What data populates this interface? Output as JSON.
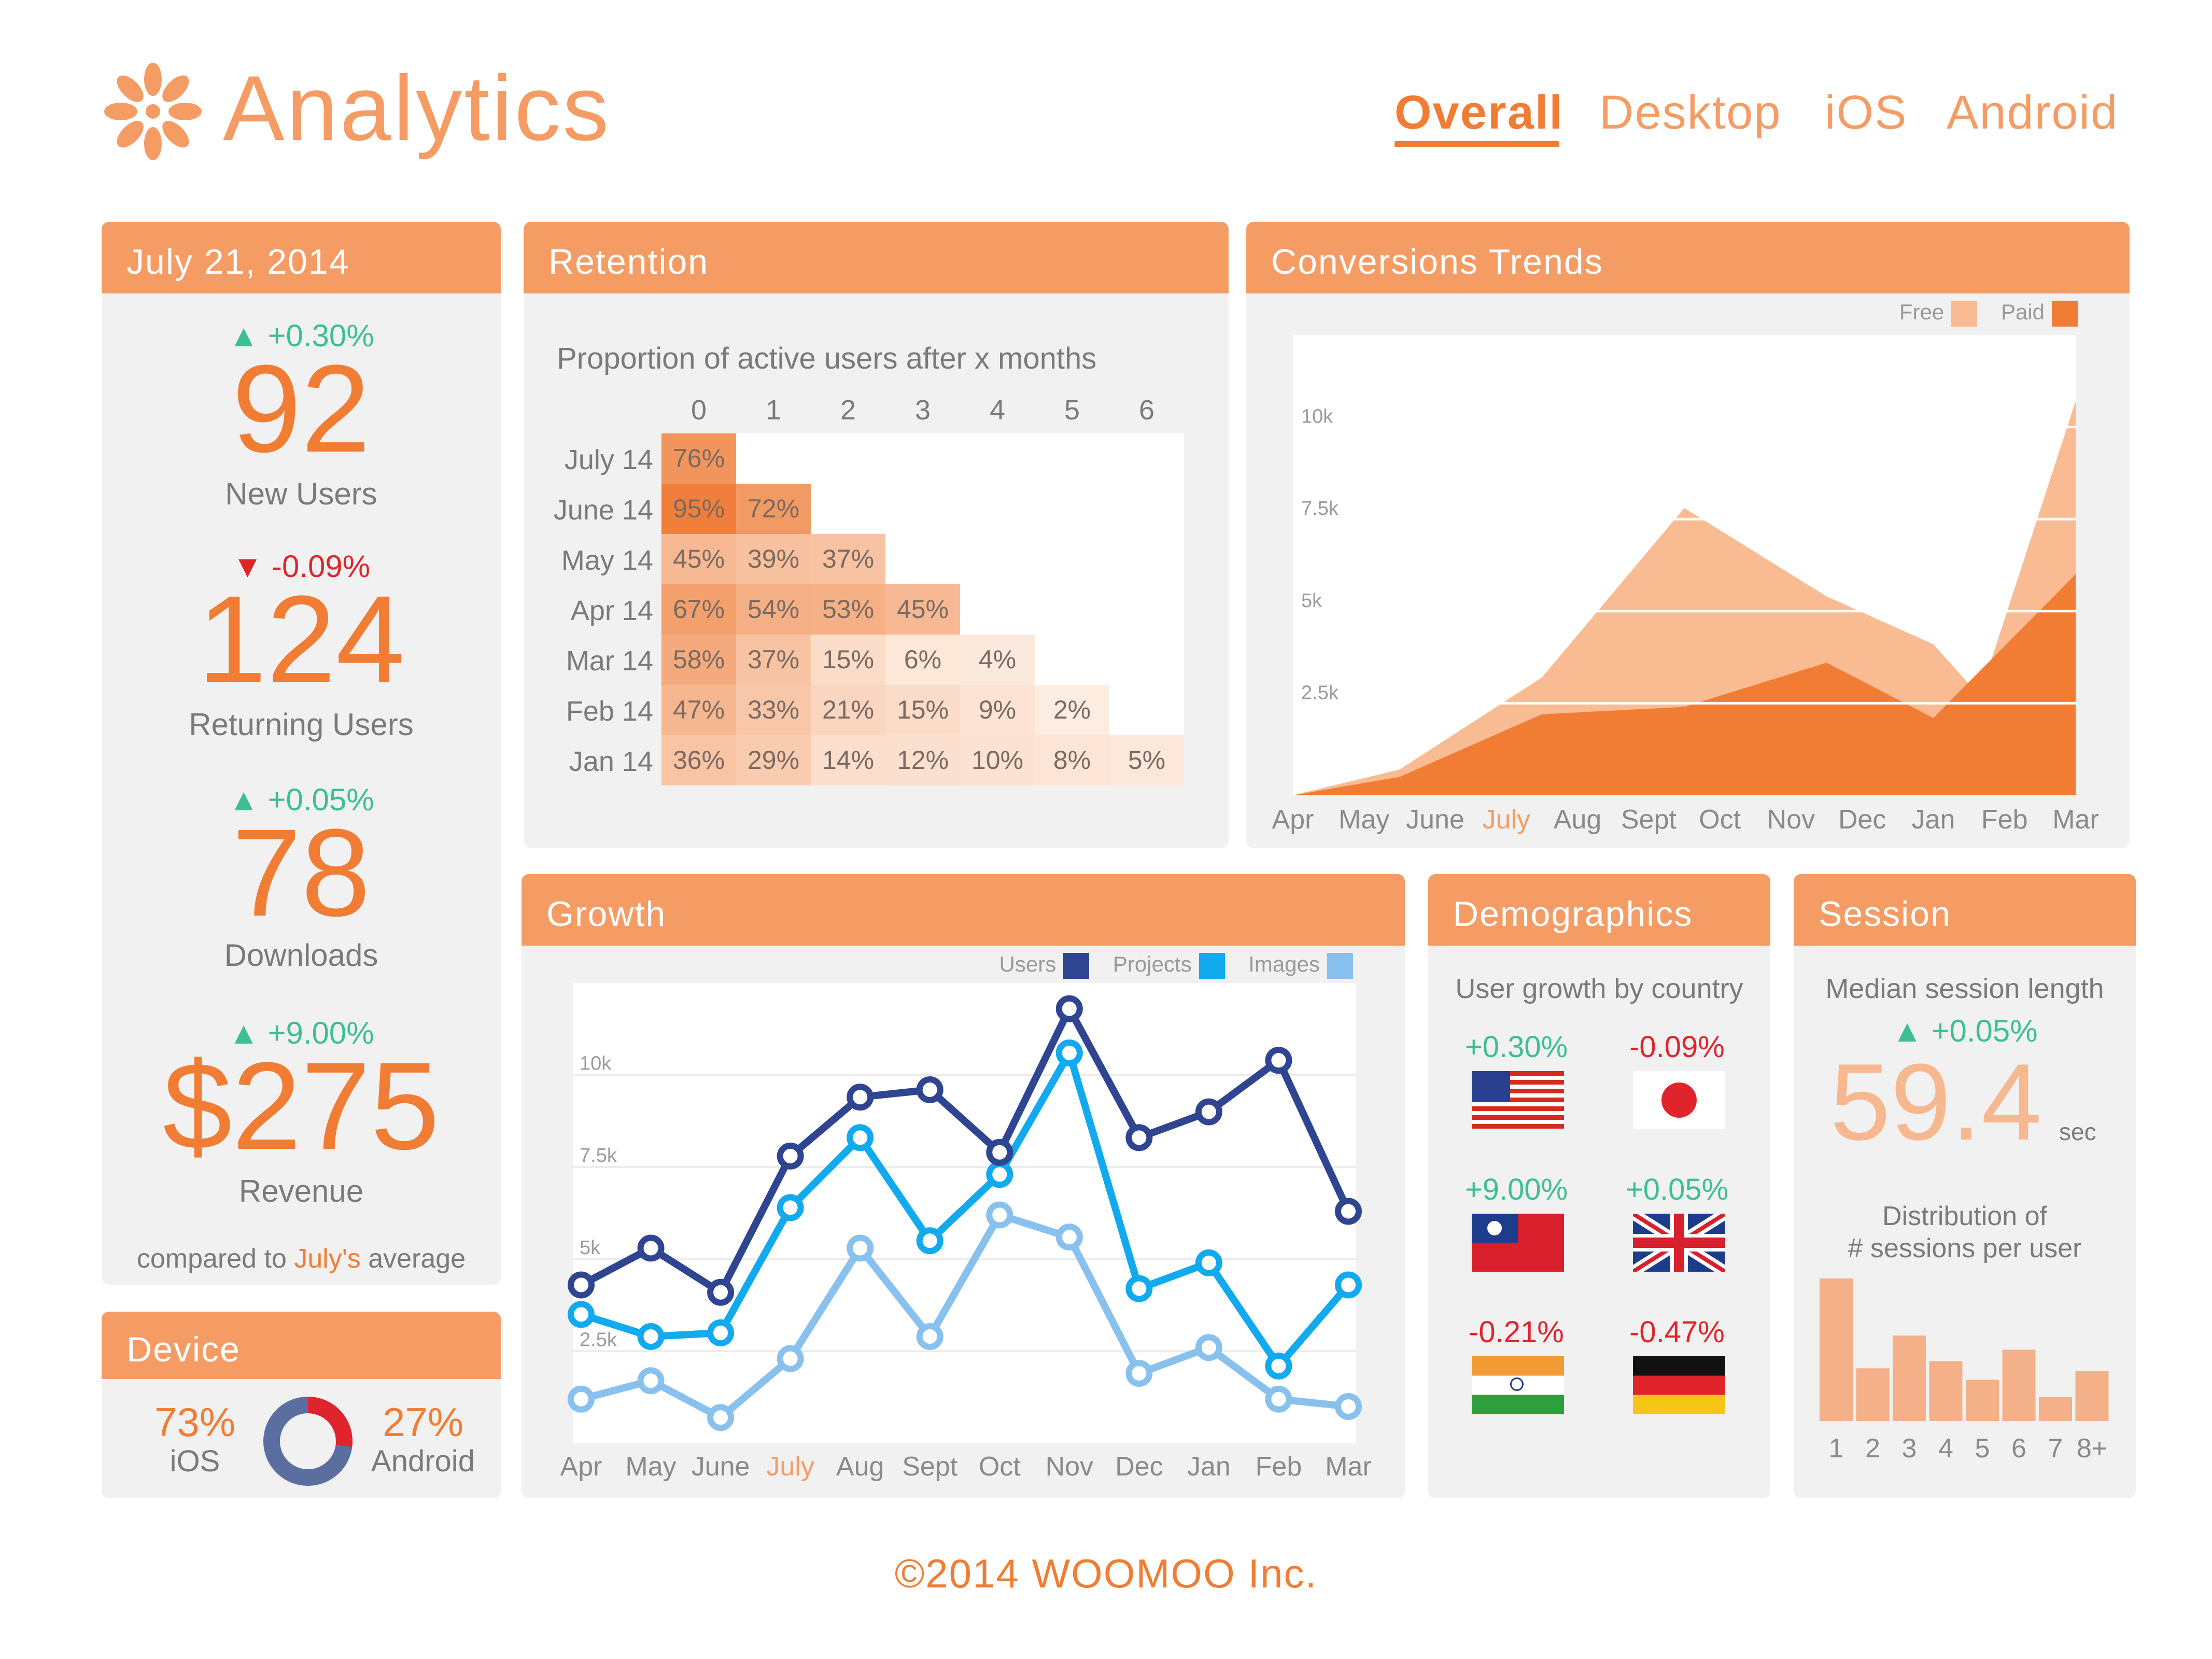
{
  "app": {
    "title": "Analytics",
    "logo_icon": "flower-icon"
  },
  "tabs": [
    {
      "label": "Overall",
      "active": true
    },
    {
      "label": "Desktop",
      "active": false
    },
    {
      "label": "iOS",
      "active": false
    },
    {
      "label": "Android",
      "active": false
    }
  ],
  "summary": {
    "date": "July 21, 2014",
    "metrics": [
      {
        "change": "+0.30%",
        "direction": "up",
        "value": "92",
        "label": "New Users"
      },
      {
        "change": "-0.09%",
        "direction": "down",
        "value": "124",
        "label": "Returning Users"
      },
      {
        "change": "+0.05%",
        "direction": "up",
        "value": "78",
        "label": "Downloads"
      },
      {
        "change": "+9.00%",
        "direction": "up",
        "value": "$275",
        "label": "Revenue"
      }
    ],
    "footer_prefix": "compared to ",
    "footer_highlight": "July's",
    "footer_suffix": " average"
  },
  "device": {
    "title": "Device",
    "ios_pct": "73%",
    "ios_label": "iOS",
    "android_pct": "27%",
    "android_label": "Android",
    "ios_fraction": 0.73,
    "colors": {
      "ios": "#5a6ea0",
      "android": "#e0242b"
    }
  },
  "retention": {
    "title": "Retention",
    "subtitle": "Proportion of active users after x months",
    "columns": [
      "0",
      "1",
      "2",
      "3",
      "4",
      "5",
      "6"
    ],
    "rows": [
      {
        "label": "July 14",
        "values": [
          "76%"
        ]
      },
      {
        "label": "June 14",
        "values": [
          "95%",
          "72%"
        ]
      },
      {
        "label": "May 14",
        "values": [
          "45%",
          "39%",
          "37%"
        ]
      },
      {
        "label": "Apr 14",
        "values": [
          "67%",
          "54%",
          "53%",
          "45%"
        ]
      },
      {
        "label": "Mar 14",
        "values": [
          "58%",
          "37%",
          "15%",
          "6%",
          "4%"
        ]
      },
      {
        "label": "Feb 14",
        "values": [
          "47%",
          "33%",
          "21%",
          "15%",
          "9%",
          "2%"
        ]
      },
      {
        "label": "Jan 14",
        "values": [
          "36%",
          "29%",
          "14%",
          "12%",
          "10%",
          "8%",
          "5%"
        ]
      }
    ]
  },
  "conversions": {
    "title": "Conversions Trends",
    "legend": [
      "Free",
      "Paid"
    ],
    "chart_data": {
      "type": "area",
      "categories": [
        "Apr",
        "May",
        "June",
        "July",
        "Aug",
        "Sept",
        "Oct",
        "Nov",
        "Dec",
        "Jan",
        "Feb",
        "Mar"
      ],
      "highlight_category": "July",
      "ylim": [
        0,
        12500
      ],
      "yticks": [
        "2.5k",
        "5k",
        "7.5k",
        "10k"
      ],
      "ytick_values": [
        2500,
        5000,
        7500,
        10000
      ],
      "series": [
        {
          "name": "Free",
          "color": "#f8bb92",
          "values": [
            0,
            700,
            3200,
            7800,
            5400,
            4100,
            2700,
            10700
          ]
        },
        {
          "name": "Paid",
          "color": "#f07d33",
          "values": [
            0,
            500,
            2200,
            2400,
            3600,
            2100,
            6000
          ]
        }
      ],
      "free_x": [
        0,
        1.5,
        3.5,
        5.5,
        7.5,
        9.0,
        9.65,
        11.0
      ],
      "paid_x": [
        0,
        1.5,
        3.5,
        5.5,
        7.5,
        9.0,
        11.0
      ]
    }
  },
  "growth": {
    "title": "Growth",
    "legend": [
      "Users",
      "Projects",
      "Images"
    ],
    "chart_data": {
      "type": "line",
      "categories": [
        "Apr",
        "May",
        "June",
        "July",
        "Aug",
        "Sept",
        "Oct",
        "Nov",
        "Dec",
        "Jan",
        "Feb",
        "Mar"
      ],
      "highlight_category": "July",
      "ylim": [
        0,
        12500
      ],
      "yticks": [
        "2.5k",
        "5k",
        "7.5k",
        "10k"
      ],
      "ytick_values": [
        2500,
        5000,
        7500,
        10000
      ],
      "series": [
        {
          "name": "Users",
          "color": "#2f4591",
          "values": [
            4300,
            5300,
            4100,
            7800,
            9400,
            9600,
            7900,
            11800,
            8300,
            9000,
            10400,
            6300
          ]
        },
        {
          "name": "Projects",
          "color": "#12aaee",
          "values": [
            3500,
            2900,
            3000,
            6400,
            8300,
            5500,
            7300,
            10600,
            4200,
            4900,
            2100,
            4300
          ]
        },
        {
          "name": "Images",
          "color": "#88c1ee",
          "values": [
            1200,
            1700,
            700,
            2300,
            5300,
            2900,
            6200,
            5600,
            1900,
            2600,
            1200,
            1000
          ]
        }
      ]
    }
  },
  "demographics": {
    "title": "Demographics",
    "subtitle": "User growth by country",
    "countries": [
      {
        "change": "+0.30%",
        "direction": "up",
        "flag": "usa-flag-icon"
      },
      {
        "change": "-0.09%",
        "direction": "down",
        "flag": "japan-flag-icon"
      },
      {
        "change": "+9.00%",
        "direction": "up",
        "flag": "taiwan-flag-icon"
      },
      {
        "change": "+0.05%",
        "direction": "up",
        "flag": "uk-flag-icon"
      },
      {
        "change": "-0.21%",
        "direction": "down",
        "flag": "india-flag-icon"
      },
      {
        "change": "-0.47%",
        "direction": "down",
        "flag": "germany-flag-icon"
      }
    ]
  },
  "session": {
    "title": "Session",
    "subtitle": "Median session length",
    "change": "+0.05%",
    "value": "59.4",
    "unit": "sec",
    "dist_title_1": "Distribution of",
    "dist_title_2": "# sessions per user",
    "chart_data": {
      "type": "bar",
      "categories": [
        "1",
        "2",
        "3",
        "4",
        "5",
        "6",
        "7",
        "8+"
      ],
      "values": [
        100,
        37,
        60,
        42,
        29,
        50,
        17,
        35
      ],
      "color": "#f4b088"
    }
  },
  "footer": {
    "copyright": "©2014 WOOMOO Inc."
  },
  "colors": {
    "accent": "#f07d33",
    "header": "#f59c65",
    "positive": "#3cc08f",
    "negative": "#e0242b"
  }
}
